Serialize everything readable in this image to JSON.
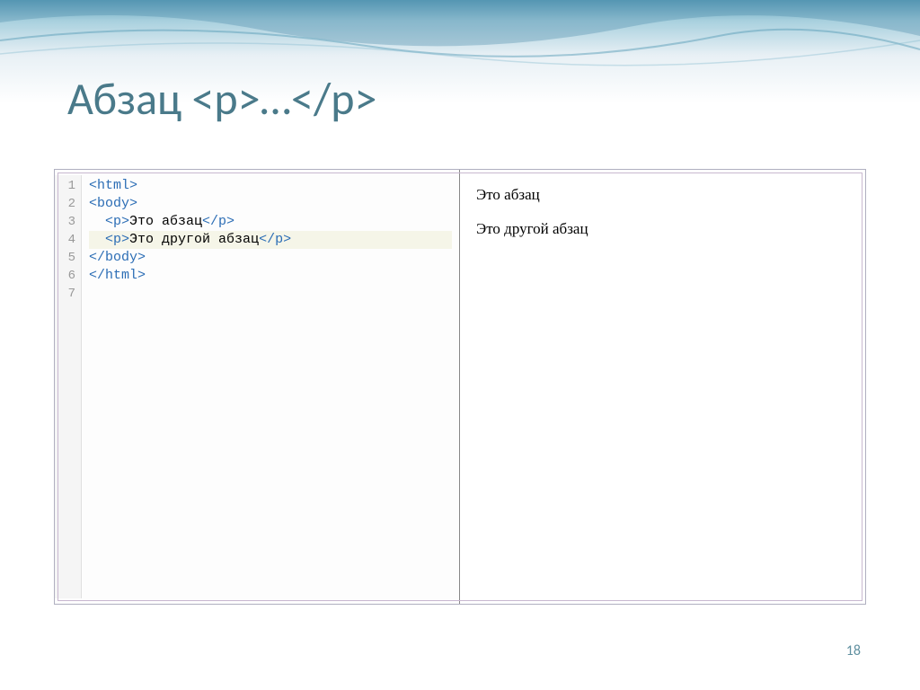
{
  "slide": {
    "title": "Абзац  <p>…</p>",
    "page_number": "18"
  },
  "code": {
    "lines": [
      "1",
      "2",
      "3",
      "4",
      "5",
      "6",
      "7"
    ],
    "line1": {
      "tag": "<html>"
    },
    "line2": {
      "tag": "<body>"
    },
    "line3": {
      "indent": "  ",
      "open": "<p>",
      "text": "Это абзац",
      "close": "</p>"
    },
    "line4": {
      "indent": "  ",
      "open": "<p>",
      "text": "Это другой абзац",
      "close": "</p>"
    },
    "line5": {
      "tag": "</body>"
    },
    "line6": {
      "tag": "</html>"
    }
  },
  "preview": {
    "p1": "Это абзац",
    "p2": "Это другой абзац"
  }
}
